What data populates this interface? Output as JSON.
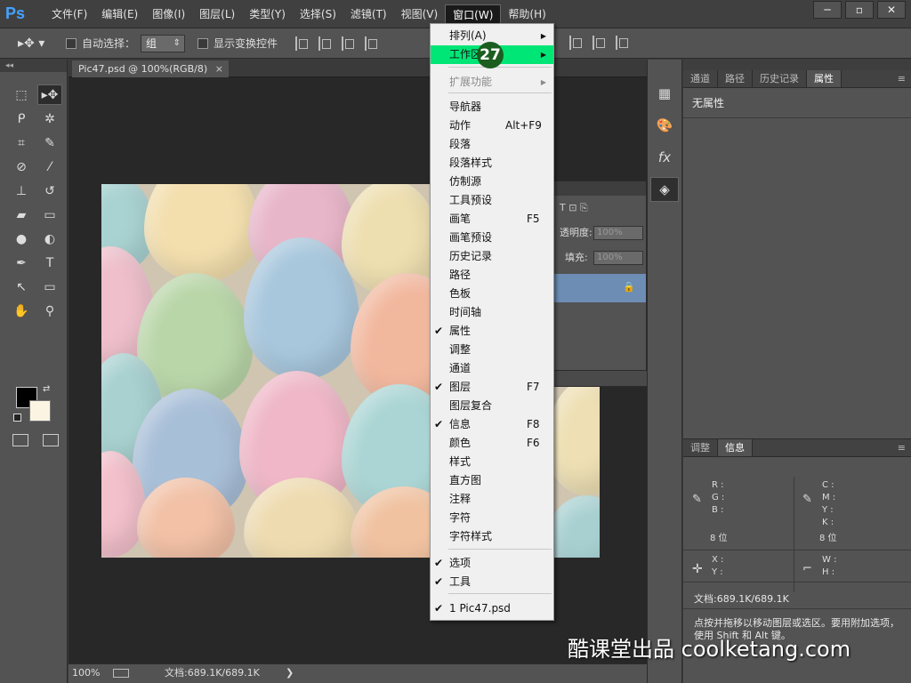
{
  "app": {
    "logo": "Ps"
  },
  "menubar": {
    "items": [
      "文件(F)",
      "编辑(E)",
      "图像(I)",
      "图层(L)",
      "类型(Y)",
      "选择(S)",
      "滤镜(T)",
      "视图(V)",
      "窗口(W)",
      "帮助(H)"
    ],
    "active": "窗口(W)"
  },
  "window_controls": {
    "minimize": "─",
    "maximize": "▫",
    "close": "✕"
  },
  "options": {
    "auto_select_label": "自动选择：",
    "auto_select_value": "组",
    "show_transform_label": "显示变换控件"
  },
  "document": {
    "tab_title": "Pic47.psd @ 100%(RGB/8)",
    "tab_close": "×"
  },
  "status": {
    "zoom": "100%",
    "doc_info": "文档:689.1K/689.1K",
    "arrow": "❯"
  },
  "layers_panel": {
    "opacity_label": "透明度:",
    "opacity_value": "100%",
    "fill_label": "填充:",
    "fill_value": "100%"
  },
  "properties_panel": {
    "tabs": [
      "通道",
      "路径",
      "历史记录",
      "属性"
    ],
    "active_tab": "属性",
    "body_label": "无属性"
  },
  "info_panel": {
    "tabs": [
      "调整",
      "信息"
    ],
    "active_tab": "信息",
    "rgb_labels": [
      "R :",
      "G :",
      "B :"
    ],
    "cmyk_labels": [
      "C :",
      "M :",
      "Y :",
      "K :"
    ],
    "bits_left": "8 位",
    "bits_right": "8 位",
    "xy_labels": [
      "X :",
      "Y :"
    ],
    "wh_labels": [
      "W :",
      "H :"
    ],
    "doc_info": "文档:689.1K/689.1K",
    "hint": "点按并拖移以移动图层或选区。要用附加选项，使用 Shift 和 Alt 键。"
  },
  "window_menu": {
    "items": [
      {
        "label": "排列(A)",
        "submenu": true
      },
      {
        "label": "工作区",
        "submenu": true,
        "highlighted": true
      },
      {
        "label": "扩展功能",
        "submenu": true,
        "disabled": true
      },
      {
        "label": "导航器"
      },
      {
        "label": "动作",
        "shortcut": "Alt+F9"
      },
      {
        "label": "段落"
      },
      {
        "label": "段落样式"
      },
      {
        "label": "仿制源"
      },
      {
        "label": "工具预设"
      },
      {
        "label": "画笔",
        "shortcut": "F5"
      },
      {
        "label": "画笔预设"
      },
      {
        "label": "历史记录"
      },
      {
        "label": "路径"
      },
      {
        "label": "色板"
      },
      {
        "label": "时间轴"
      },
      {
        "label": "属性",
        "checked": true
      },
      {
        "label": "调整"
      },
      {
        "label": "通道"
      },
      {
        "label": "图层",
        "shortcut": "F7",
        "checked": true
      },
      {
        "label": "图层复合"
      },
      {
        "label": "信息",
        "shortcut": "F8",
        "checked": true
      },
      {
        "label": "颜色",
        "shortcut": "F6"
      },
      {
        "label": "样式"
      },
      {
        "label": "直方图"
      },
      {
        "label": "注释"
      },
      {
        "label": "字符"
      },
      {
        "label": "字符样式"
      },
      {
        "label": "选项",
        "checked": true
      },
      {
        "label": "工具",
        "checked": true
      },
      {
        "label": "1 Pic47.psd",
        "checked": true
      }
    ],
    "check_glyph": "✔",
    "submenu_glyph": "▶"
  },
  "step_badge": "27",
  "watermark": "酷课堂出品 coolketang.com",
  "colors": {
    "menu_highlight": "#00e676",
    "badge": "#1b5e20",
    "foreground_swatch": "#000000",
    "background_swatch": "#fbf4e3",
    "selected_layer": "#6d8db4"
  }
}
